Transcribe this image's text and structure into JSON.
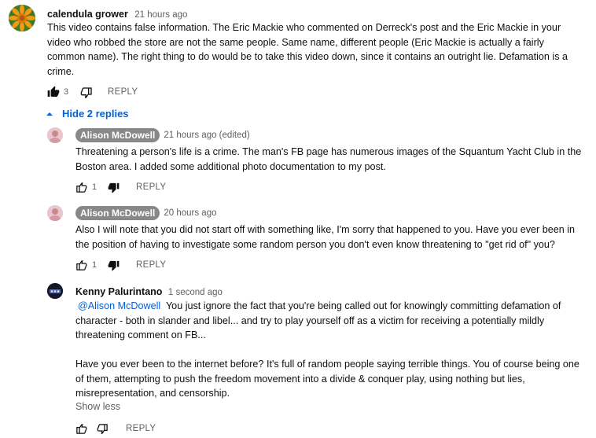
{
  "comment": {
    "author": "calendula grower",
    "time": "21 hours ago",
    "text_lines": [
      "This video contains false information.  The Eric Mackie who commented on Derreck's post and the Eric Mackie in your",
      "video who robbed the store are not the same people.  Same name, different people (Eric Mackie is actually a fairly",
      "common name).  The right thing to do would be to take this video down, since it contains an outright lie.  Defamation is a",
      "crime."
    ],
    "like_count": "3",
    "reply_label": "REPLY"
  },
  "replies_toggle": {
    "label": "Hide 2 replies"
  },
  "replies": [
    {
      "author": "Alison McDowell",
      "time": "21 hours ago (edited)",
      "text_lines": [
        "Threatening a person's life is a crime. The man's FB page has numerous images of the Squantum Yacht Club in the",
        "Boston area. I added some additional photo documentation to my post."
      ],
      "like_count": "1",
      "reply_label": "REPLY"
    },
    {
      "author": "Alison McDowell",
      "time": "20 hours ago",
      "text_lines": [
        "Also I will note that you did not start off with something like, I'm sorry that happened to you. Have you ever been in",
        "the position of having to investigate some random person you don't even know  threatening to \"get rid of\" you?"
      ],
      "like_count": "1",
      "reply_label": "REPLY"
    },
    {
      "author": "Kenny Palurintano",
      "time": "1 second ago",
      "mention": "@Alison McDowell",
      "first_line_rest": "  You just ignore the fact that you're being called out for knowingly committing defamation of",
      "text_lines": [
        "character - both in slander and libel... and try to play yourself off as a victim for receiving a potentially mildly",
        "threatening comment on FB...",
        "",
        "Have you ever been to the internet before? It's full of random people saying terrible things. You of course being one",
        "of them, attempting to push the freedom movement into a divide & conquer play, using nothing but lies,",
        "misrepresentation, and censorship."
      ],
      "show_less": "Show less",
      "reply_label": "REPLY"
    }
  ],
  "icons": {
    "like": "thumb-up-icon",
    "dislike": "thumb-down-icon",
    "toggle": "chevron-up-icon"
  },
  "colors": {
    "link": "#065fd4",
    "liked": "#0f0f0f",
    "muted": "#606060",
    "author_chip": "#888888"
  }
}
